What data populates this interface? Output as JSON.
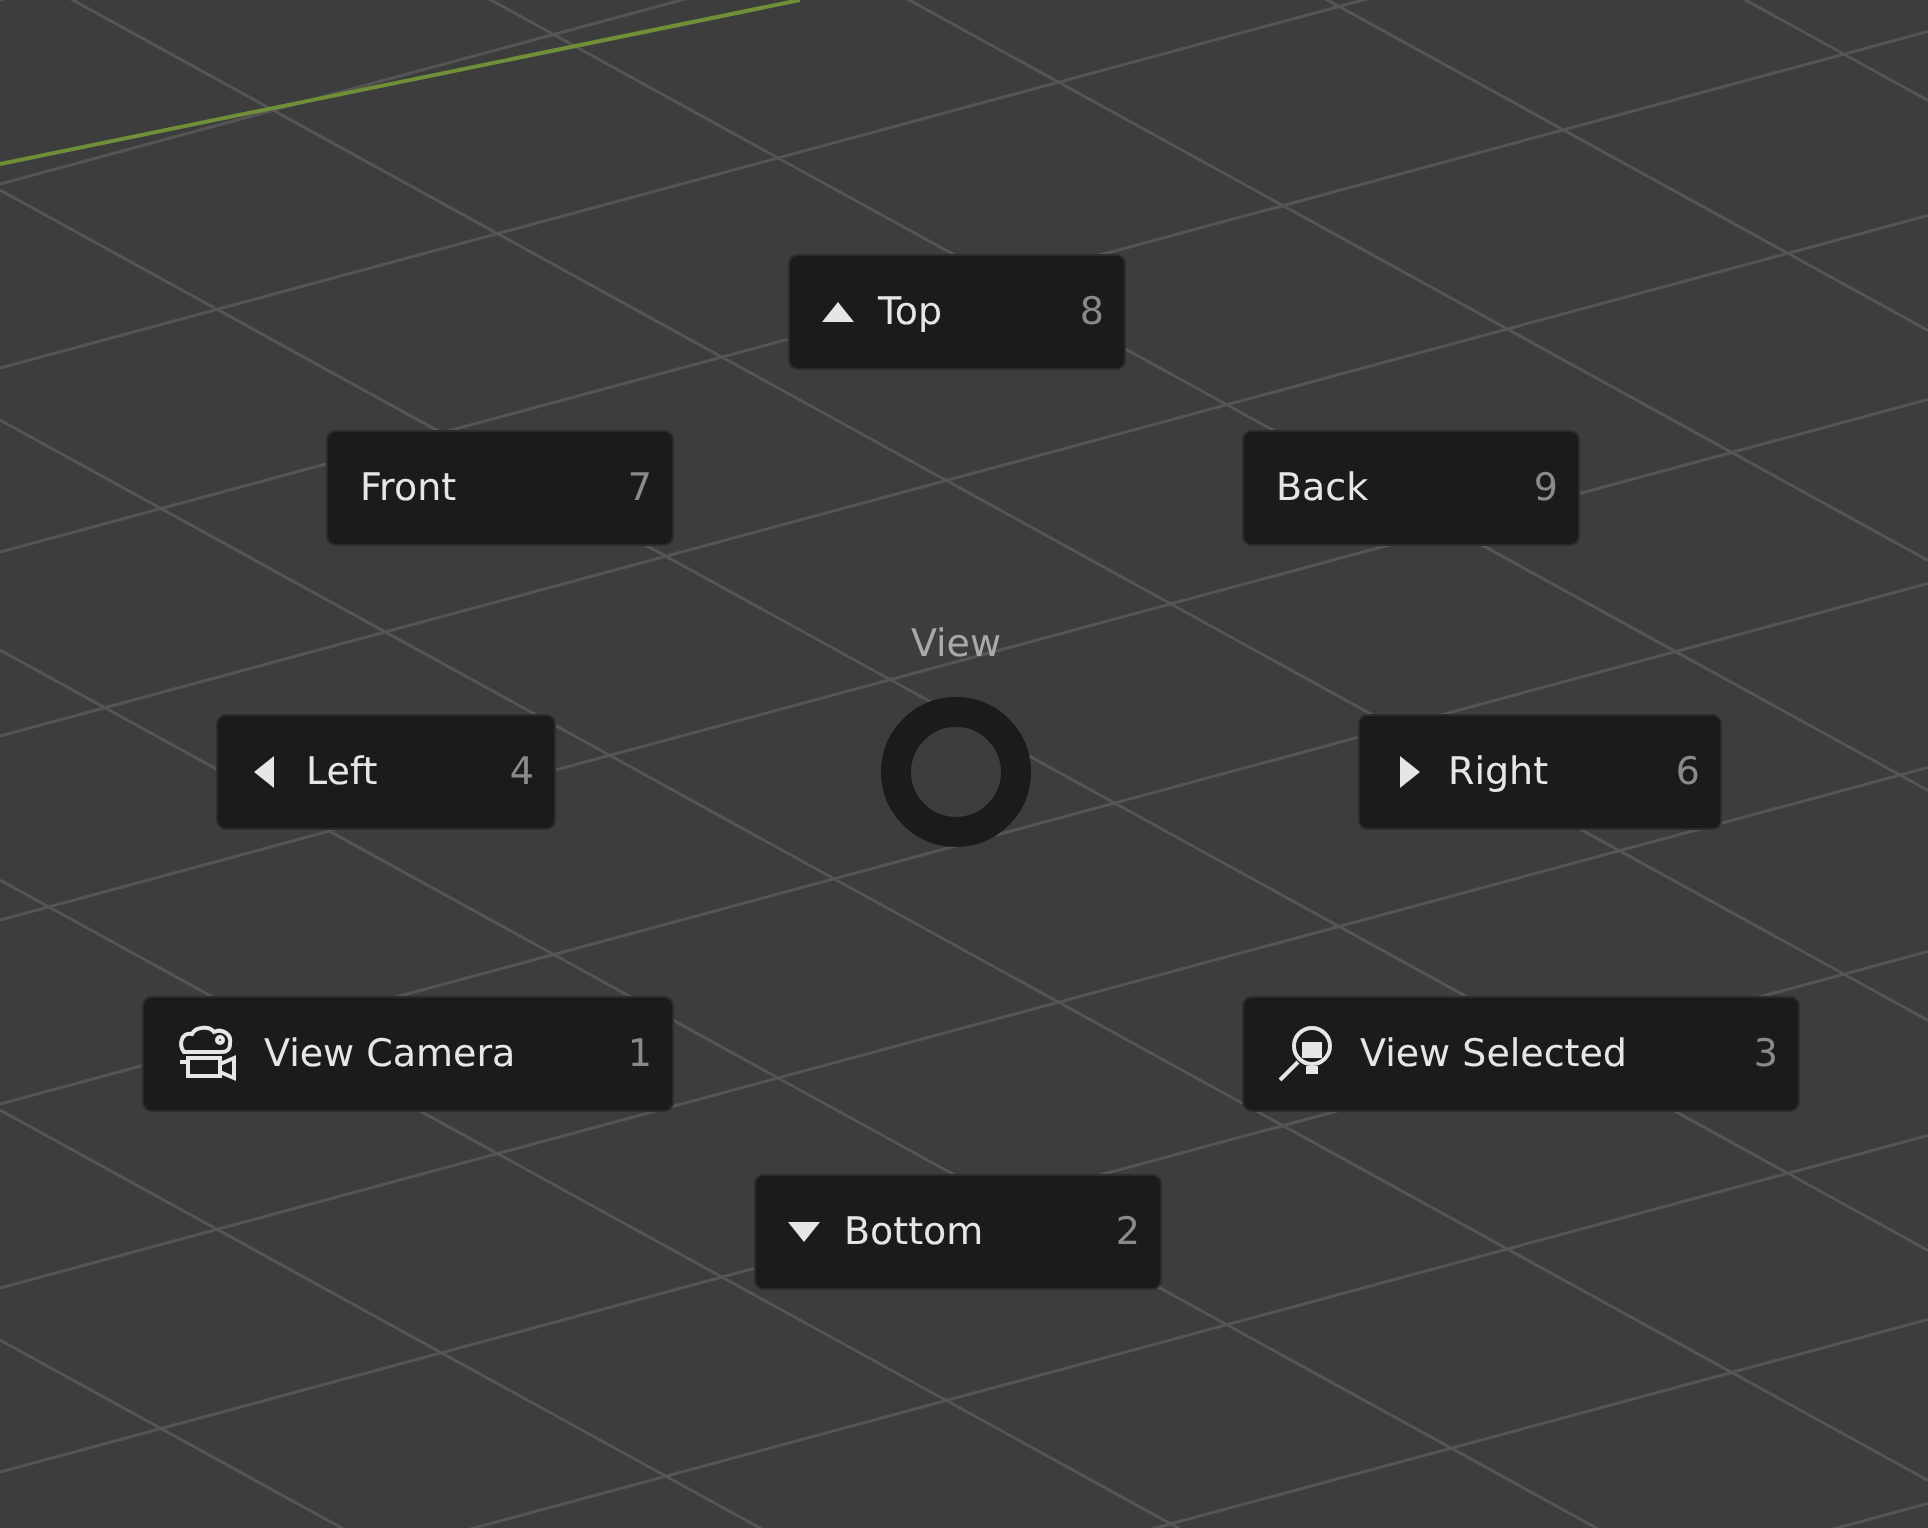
{
  "pie_menu": {
    "title": "View",
    "items": [
      {
        "kind": "triangle-up",
        "label": "Top",
        "shortcut": "8"
      },
      {
        "kind": "none",
        "label": "Front",
        "shortcut": "7"
      },
      {
        "kind": "none",
        "label": "Back",
        "shortcut": "9"
      },
      {
        "kind": "triangle-left",
        "label": "Left",
        "shortcut": "4"
      },
      {
        "kind": "triangle-right",
        "label": "Right",
        "shortcut": "6"
      },
      {
        "kind": "camera",
        "label": "View Camera",
        "shortcut": "1"
      },
      {
        "kind": "zoom-selected",
        "label": "View Selected",
        "shortcut": "3"
      },
      {
        "kind": "triangle-down",
        "label": "Bottom",
        "shortcut": "2"
      }
    ]
  }
}
